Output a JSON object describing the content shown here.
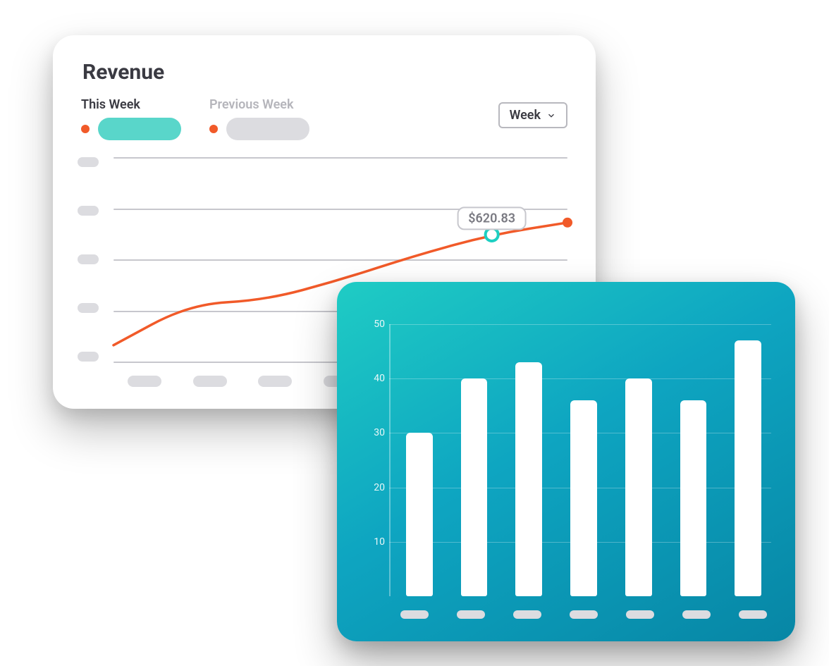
{
  "revenue_card": {
    "title": "Revenue",
    "legend_this": "This Week",
    "legend_prev": "Previous Week",
    "period_selected": "Week",
    "tooltip_value": "$620.83",
    "colors": {
      "accent_line": "#f15a29",
      "legend_pill_active": "#59d6ca",
      "legend_pill_inactive": "#dcdce0",
      "tooltip_ring": "#1ccfc2"
    }
  },
  "bar_card": {
    "y_ticks": [
      "50",
      "40",
      "30",
      "20",
      "10"
    ]
  },
  "chart_data": [
    {
      "type": "line",
      "title": "Revenue",
      "series_labels": [
        "This Week",
        "Previous Week"
      ],
      "x_categories_count": 7,
      "ylim": [
        0,
        1000
      ],
      "series": [
        {
          "name": "This Week",
          "values": [
            80,
            280,
            300,
            400,
            520,
            620.83,
            680
          ]
        }
      ],
      "highlight": {
        "index": 5,
        "value": 620.83,
        "label": "$620.83"
      }
    },
    {
      "type": "bar",
      "ylim": [
        0,
        50
      ],
      "y_ticks": [
        10,
        20,
        30,
        40,
        50
      ],
      "categories_count": 7,
      "values": [
        30,
        40,
        43,
        36,
        40,
        36,
        47
      ]
    }
  ]
}
